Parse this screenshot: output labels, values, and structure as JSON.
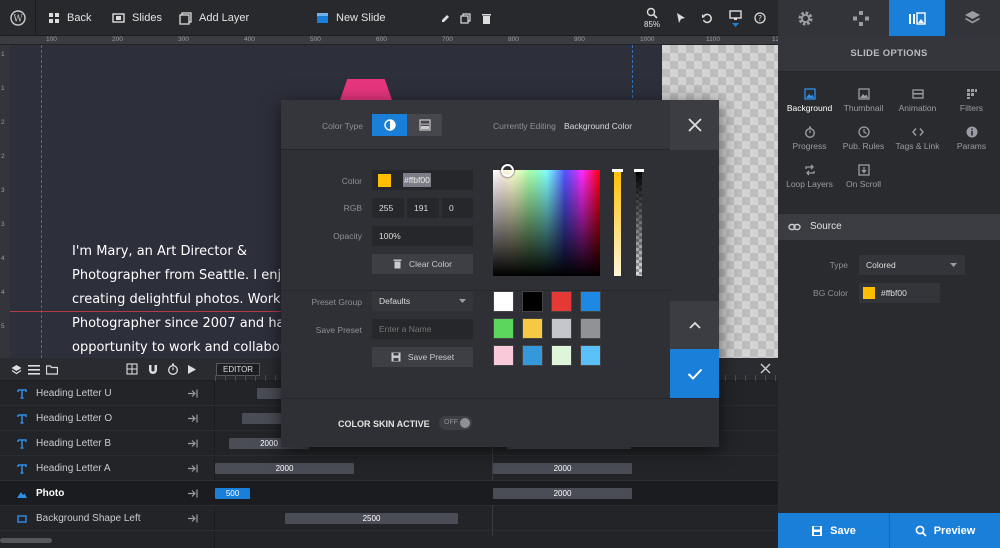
{
  "topbar": {
    "back": "Back",
    "slides": "Slides",
    "add_layer": "Add Layer",
    "new_slide": "New Slide",
    "zoom": "85%"
  },
  "ruler": {
    "ticks": [
      "100",
      "200",
      "300",
      "400",
      "500",
      "600",
      "700",
      "800",
      "900",
      "1000",
      "1100",
      "1200"
    ],
    "vticks": [
      "1",
      "1",
      "2",
      "2",
      "3",
      "3",
      "4",
      "4",
      "5"
    ]
  },
  "slide_text": [
    "I'm Mary, an Art Director &",
    "Photographer from Seattle. I enjo",
    "creating delightful photos. Workin",
    "Photographer since 2007 and had",
    "opportunity to work and collabora"
  ],
  "timeline": {
    "editor_label": "EDITOR",
    "layers": [
      {
        "name": "Heading Letter U",
        "icon": "text-icon",
        "bars": []
      },
      {
        "name": "Heading Letter O",
        "icon": "text-icon",
        "bars": []
      },
      {
        "name": "Heading Letter B",
        "icon": "text-icon",
        "bars": [
          "2000",
          "2000"
        ]
      },
      {
        "name": "Heading Letter A",
        "icon": "text-icon",
        "bars": [
          "2000",
          "2000"
        ]
      },
      {
        "name": "Photo",
        "icon": "image-icon",
        "bars": [
          "500",
          "2000"
        ]
      },
      {
        "name": "Background Shape Left",
        "icon": "shape-icon",
        "bars": [
          "2500"
        ]
      }
    ]
  },
  "modal": {
    "color_type_label": "Color Type",
    "currently_editing_label": "Currently Editing",
    "currently_editing_value": "Background Color",
    "color_label": "Color",
    "color_value": "#ffbf00",
    "rgb_label": "RGB",
    "r": "255",
    "g": "191",
    "b": "0",
    "opacity_label": "Opacity",
    "opacity_value": "100%",
    "clear_color": "Clear Color",
    "preset_group_label": "Preset Group",
    "preset_group_value": "Defaults",
    "save_preset_label": "Save Preset",
    "preset_placeholder": "Enter a Name",
    "save_preset_button": "Save Preset",
    "color_skin_label": "COLOR SKIN ACTIVE",
    "toggle_state": "OFF",
    "swatches": [
      "#ffffff",
      "#000000",
      "#e53935",
      "#1e88e5",
      "#5cd65c",
      "#f7c843",
      "#c4c6cc",
      "#909297",
      "#f7c9d9",
      "#3498db",
      "#dff5d9",
      "#5bc0f8"
    ]
  },
  "side": {
    "tabs": [
      "gear-icon",
      "gamepad-icon",
      "slides-icon",
      "layers-icon"
    ],
    "title": "SLIDE OPTIONS",
    "options": [
      {
        "label": "Background",
        "icon": "image-icon"
      },
      {
        "label": "Thumbnail",
        "icon": "image-icon"
      },
      {
        "label": "Animation",
        "icon": "film-icon"
      },
      {
        "label": "Filters",
        "icon": "grid-icon"
      },
      {
        "label": "Progress",
        "icon": "timer-icon"
      },
      {
        "label": "Pub. Rules",
        "icon": "clock-icon"
      },
      {
        "label": "Tags & Link",
        "icon": "code-icon"
      },
      {
        "label": "Params",
        "icon": "info-icon"
      },
      {
        "label": "Loop Layers",
        "icon": "loop-icon"
      },
      {
        "label": "On Scroll",
        "icon": "scroll-icon"
      }
    ],
    "source_label": "Source",
    "type_label": "Type",
    "type_value": "Colored",
    "bg_color_label": "BG Color",
    "bg_color_value": "#ffbf00",
    "save": "Save",
    "preview": "Preview"
  },
  "colors": {
    "accent": "#1a7fd9",
    "selected_color": "#ffbf00",
    "slide_shape": "#e8367e"
  }
}
